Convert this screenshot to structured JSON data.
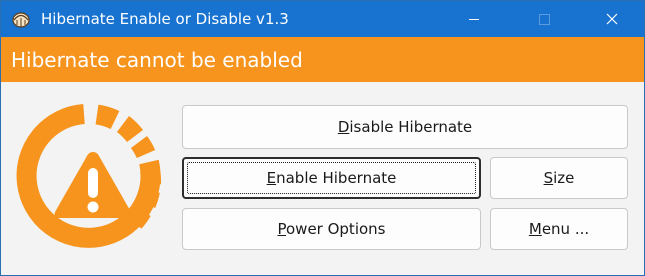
{
  "window": {
    "title": "Hibernate Enable or Disable v1.3",
    "app_icon": "shell-icon",
    "controls": {
      "minimize": "minimize-icon",
      "maximize": "maximize-icon",
      "close": "close-icon"
    }
  },
  "banner": {
    "text": "Hibernate cannot be enabled",
    "color": "#f7941d"
  },
  "status_icon": "warning-icon",
  "buttons": {
    "disable": {
      "mnemonic": "D",
      "rest": "isable Hibernate"
    },
    "enable": {
      "mnemonic": "E",
      "rest": "nable Hibernate"
    },
    "size": {
      "mnemonic": "S",
      "rest": "ize"
    },
    "power": {
      "mnemonic": "P",
      "rest": "ower Options"
    },
    "menu": {
      "mnemonic": "M",
      "rest": "enu ..."
    }
  },
  "colors": {
    "titlebar": "#1872cf",
    "accent": "#f7941d"
  }
}
